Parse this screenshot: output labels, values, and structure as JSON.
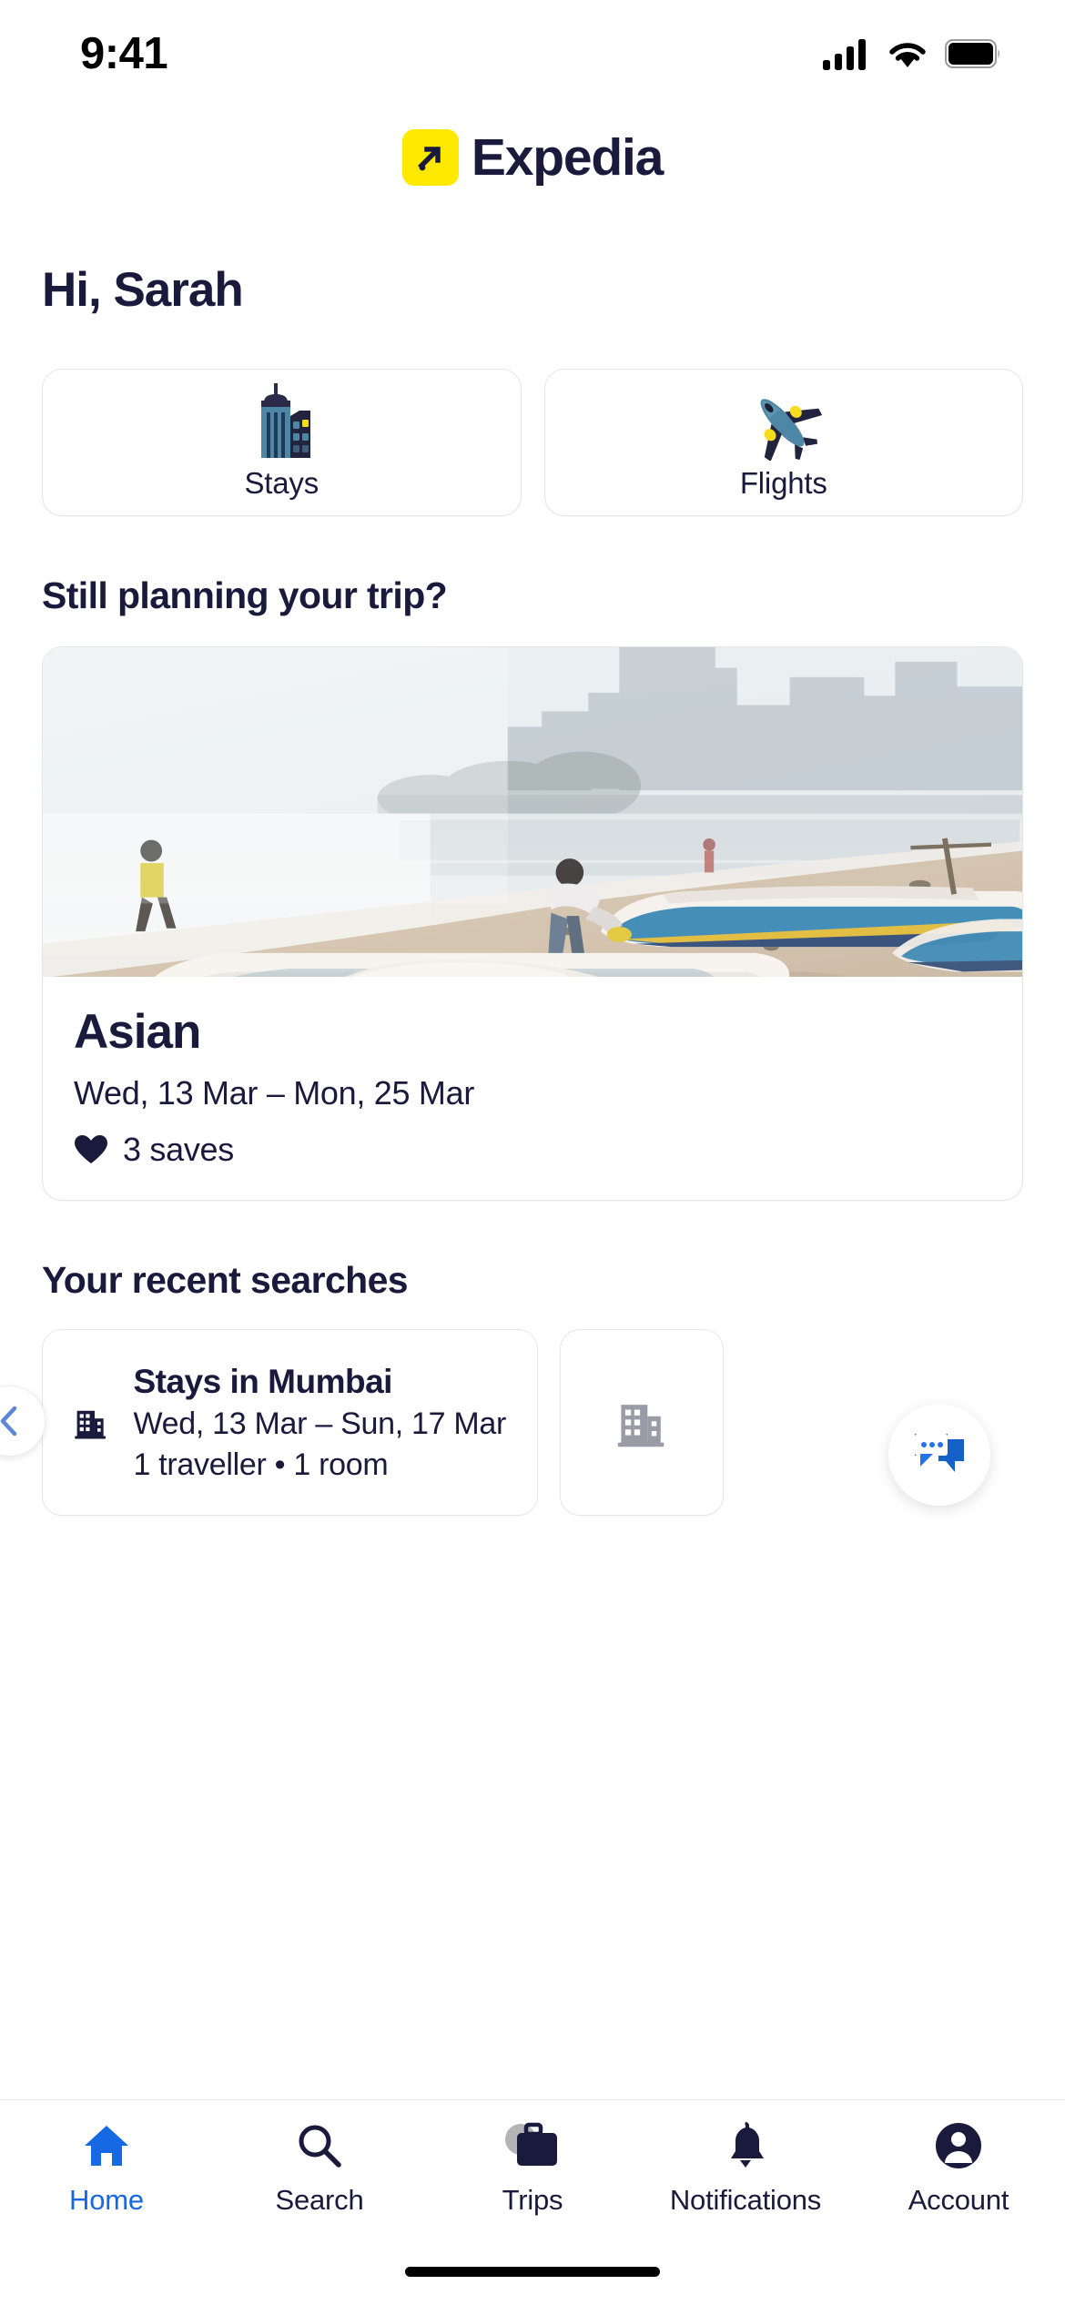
{
  "status_bar": {
    "time": "9:41",
    "cellular_icon": "signal-bars-icon",
    "wifi_icon": "wifi-icon",
    "battery_icon": "battery-full-icon"
  },
  "header": {
    "brand_name": "Expedia",
    "logo_icon": "expedia-arrow-logo-icon",
    "logo_bg": "#FFE900"
  },
  "greeting": "Hi, Sarah",
  "quick_actions": [
    {
      "label": "Stays",
      "icon": "buildings-illustration-icon"
    },
    {
      "label": "Flights",
      "icon": "airplane-illustration-icon"
    }
  ],
  "planning_section": {
    "title": "Still planning your trip?",
    "trip": {
      "name": "Asian",
      "dates": "Wed, 13 Mar – Mon, 25 Mar",
      "saves": "3 saves",
      "saves_icon": "heart-filled-icon",
      "photo_alt": "Fishing boats on a hazy beach with a city skyline"
    }
  },
  "recent_section": {
    "title": "Your recent searches",
    "prev_icon": "chevron-left-icon",
    "chat_icon": "chat-bubble-icon",
    "cards": [
      {
        "icon": "building-icon",
        "title": "Stays in Mumbai",
        "dates": "Wed, 13 Mar – Sun, 17 Mar",
        "meta": "1 traveller • 1 room"
      },
      {
        "icon": "building-icon",
        "title": "",
        "dates": "",
        "meta": ""
      }
    ]
  },
  "tab_bar": {
    "active_color": "#1668E3",
    "items": [
      {
        "label": "Home",
        "icon": "home-icon",
        "active": true
      },
      {
        "label": "Search",
        "icon": "search-icon",
        "active": false
      },
      {
        "label": "Trips",
        "icon": "suitcase-icon",
        "active": false
      },
      {
        "label": "Notifications",
        "icon": "bell-icon",
        "active": false
      },
      {
        "label": "Account",
        "icon": "person-circle-icon",
        "active": false
      }
    ]
  }
}
